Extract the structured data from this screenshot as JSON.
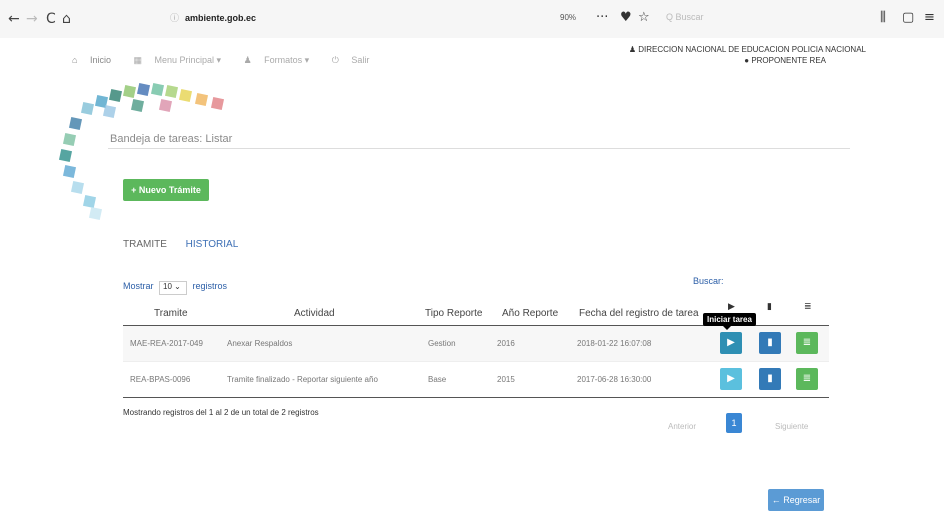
{
  "browser": {
    "back": "←",
    "forward": "→",
    "reload": "C",
    "home": "⌂",
    "url_prefix": "ⓘ",
    "url_domain": "ambiente.gob.ec",
    "zoom": "90%",
    "more": "···",
    "pocket": "♥",
    "star": "☆",
    "search_placeholder": "Q Buscar",
    "library": "⫼",
    "sidebar": "▢",
    "menu": "≡"
  },
  "app_nav": {
    "home_label": "Inicio",
    "menu_label": "Menu Principal ▾",
    "forms_label": "Formatos ▾",
    "exit_label": "Salir"
  },
  "user": {
    "organization": "DIRECCION NACIONAL DE EDUCACION POLICIA NACIONAL",
    "role": "PROPONENTE REA"
  },
  "page_title": "Bandeja de tareas: Listar",
  "new_button": "+ Nuevo Trámite",
  "tabs": [
    {
      "label": "TRAMITE"
    },
    {
      "label": "HISTORIAL"
    }
  ],
  "show": {
    "prefix": "Mostrar",
    "value": "10",
    "suffix": "registros"
  },
  "search_label": "Buscar:",
  "table": {
    "headers": [
      "Tramite",
      "Actividad",
      "Tipo Reporte",
      "Año Reporte",
      "Fecha del registro de tarea"
    ],
    "header_icons": [
      "▶",
      "▮",
      "≣"
    ],
    "rows": [
      {
        "tramite": "MAE-REA-2017-049",
        "actividad": "Anexar Respaldos",
        "tipo": "Gestion",
        "anio": "2016",
        "fecha": "2018-01-22 16:07:08"
      },
      {
        "tramite": "REA-BPAS-0096",
        "actividad": "Tramite finalizado - Reportar siguiente año",
        "tipo": "Base",
        "anio": "2015",
        "fecha": "2017-06-28 16:30:00"
      }
    ]
  },
  "tooltip": "Iniciar tarea",
  "info_text": "Mostrando registros del 1 al 2 de un total de 2 registros",
  "pager": {
    "prev": "Anterior",
    "current": "1",
    "next": "Siguiente"
  },
  "back_button": "← Regresar"
}
